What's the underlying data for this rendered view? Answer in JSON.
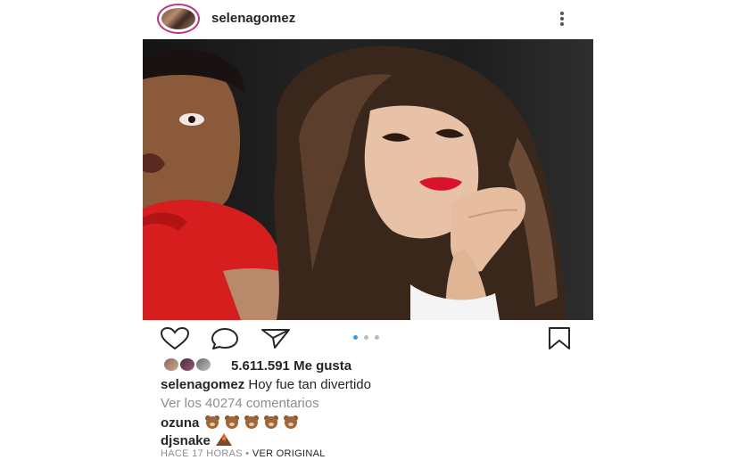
{
  "header": {
    "username": "selenagomez"
  },
  "likes": {
    "text": "5.611.591 Me gusta"
  },
  "caption": {
    "username": "selenagomez",
    "text": " Hoy fue tan divertido"
  },
  "view_comments": "Ver los 40274 comentarios",
  "comments": [
    {
      "username": "ozuna",
      "emojis": [
        "bear",
        "bear",
        "bear",
        "bear",
        "bear"
      ]
    },
    {
      "username": "djsnake",
      "emojis": [
        "volcano"
      ]
    }
  ],
  "footer": {
    "time": "HACE 17 HORAS",
    "separator": " • ",
    "view_original": "VER ORIGINAL"
  },
  "carousel": {
    "count": 3,
    "active": 1
  },
  "colors": {
    "accent": "#3897f0",
    "text": "#262626",
    "muted": "#8e8e8e"
  }
}
